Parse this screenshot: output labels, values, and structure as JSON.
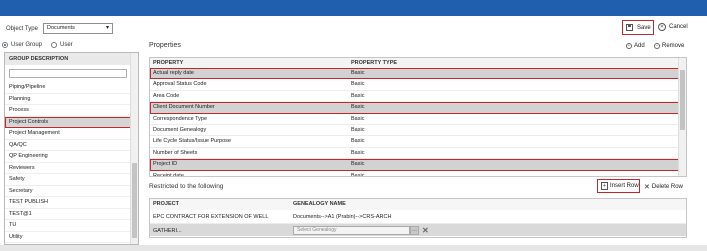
{
  "toolbar": {
    "object_type_label": "Object Type",
    "object_type_value": "Documents",
    "save_label": "Save",
    "cancel_label": "Cancel"
  },
  "left": {
    "radio_user_group": "User Group",
    "radio_user": "User",
    "selected_radio": "User Group",
    "group_header": "GROUP DESCRIPTION",
    "filter_value": "",
    "items": [
      "Piping/Pipeline",
      "Planning",
      "Process",
      "Project Controls",
      "Project Management",
      "QA/QC",
      "QP Engineering",
      "Reviewers",
      "Safety",
      "Secretary",
      "TEST PUBLISH",
      "TEST@1",
      "TU",
      "Utility"
    ],
    "selected_item": "Project Controls"
  },
  "properties": {
    "title": "Properties",
    "add_label": "Add",
    "remove_label": "Remove",
    "columns": [
      "PROPERTY",
      "PROPERTY TYPE"
    ],
    "rows": [
      {
        "property": "Actual reply date",
        "type": "Basic",
        "highlighted": true
      },
      {
        "property": "Approval Status Code",
        "type": "Basic",
        "highlighted": false
      },
      {
        "property": "Area Code",
        "type": "Basic",
        "highlighted": false
      },
      {
        "property": "Client Document Number",
        "type": "Basic",
        "highlighted": true
      },
      {
        "property": "Correspondence Type",
        "type": "Basic",
        "highlighted": false
      },
      {
        "property": "Document Genealogy",
        "type": "Basic",
        "highlighted": false
      },
      {
        "property": "Life Cycle Status/Issue Purpose",
        "type": "Basic",
        "highlighted": false
      },
      {
        "property": "Number of Sheets",
        "type": "Basic",
        "highlighted": false
      },
      {
        "property": "Project ID",
        "type": "Basic",
        "highlighted": true
      },
      {
        "property": "Receipt date",
        "type": "Basic",
        "highlighted": false
      }
    ]
  },
  "restricted": {
    "title": "Restricted to the following",
    "insert_label": "Insert Row",
    "delete_label": "Delete Row",
    "columns": [
      "PROJECT",
      "GENEALOGY NAME"
    ],
    "rows": [
      {
        "project": "EPC CONTRACT FOR EXTENSION OF WELL GATHERI...",
        "genealogy": "Documents-->A1 (Prabin)-->CRS-ARCH"
      }
    ],
    "edit_placeholder": "Select Genealogy"
  }
}
